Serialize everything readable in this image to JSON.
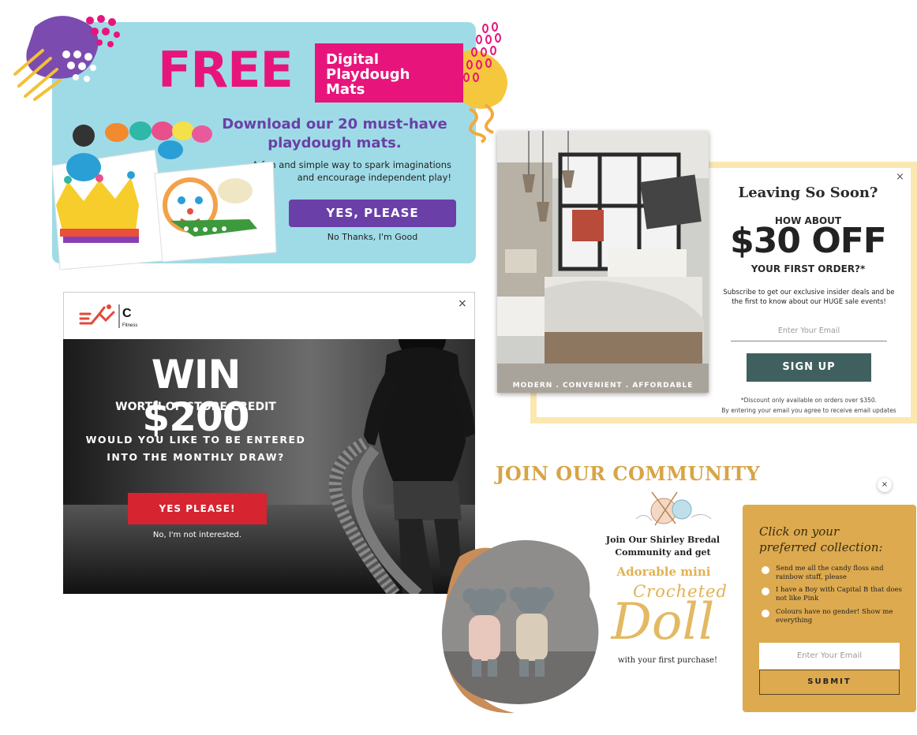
{
  "playdough": {
    "free": "FREE",
    "tag_line1": "Digital",
    "tag_line2": "Playdough",
    "tag_line3": "Mats",
    "headline_line1": "Download our 20 must-have",
    "headline_line2": "playdough mats.",
    "sub_line1": "A fun and simple way to spark imaginations",
    "sub_line2": "and encourage independent play!",
    "yes_button": "YES, PLEASE",
    "no_link": "No Thanks, I'm Good",
    "colors": {
      "bg": "#9fdbe6",
      "pink": "#e7157b",
      "purple": "#6a40a8"
    }
  },
  "bedroom": {
    "caption": "MODERN . CONVENIENT . AFFORDABLE",
    "close": "×",
    "leaving": "Leaving So Soon?",
    "how_about": "HOW ABOUT",
    "offer": "$30 OFF",
    "first_order": "YOUR FIRST ORDER?*",
    "description": "Subscribe to get our exclusive insider deals and be the first to know about our HUGE sale events!",
    "email_placeholder": "Enter Your Email",
    "signup_button": "SIGN UP",
    "disclaimer": "*Discount only available on orders over $350.",
    "agree": "By entering your email you agree to receive email updates",
    "colors": {
      "frame": "#fbe8b0",
      "button": "#3f605e"
    }
  },
  "fitness": {
    "logo_letter": "C",
    "logo_sub": "Fitness",
    "close": "×",
    "win": "WIN $200",
    "worth": "WORTH OF STORE CREDIT",
    "question_line1": "WOULD YOU LIKE TO BE ENTERED",
    "question_line2": "INTO THE MONTHLY DRAW?",
    "yes_button": "YES PLEASE!",
    "no_link": "No, I'm not interested.",
    "colors": {
      "button": "#d62430",
      "logo": "#e2483c"
    }
  },
  "community": {
    "title": "JOIN OUR COMMUNITY",
    "close": "×",
    "join_line1": "Join Our Shirley Bredal",
    "join_line2": "Community and get",
    "adorable": "Adorable mini",
    "crocheted": "Crocheted",
    "doll": "Doll",
    "first_purchase": "with your first purchase!",
    "collection_heading_line1": "Click on your",
    "collection_heading_line2": "preferred collection:",
    "options": [
      "Send me all the candy floss and rainbow stuff, please",
      "I have a Boy with Capital B that does not like Pink",
      "Colours have no gender! Show me everything"
    ],
    "email_placeholder": "Enter Your Email",
    "submit_button": "SUBMIT",
    "colors": {
      "gold": "#ddaa4f",
      "title": "#d8a446"
    }
  }
}
